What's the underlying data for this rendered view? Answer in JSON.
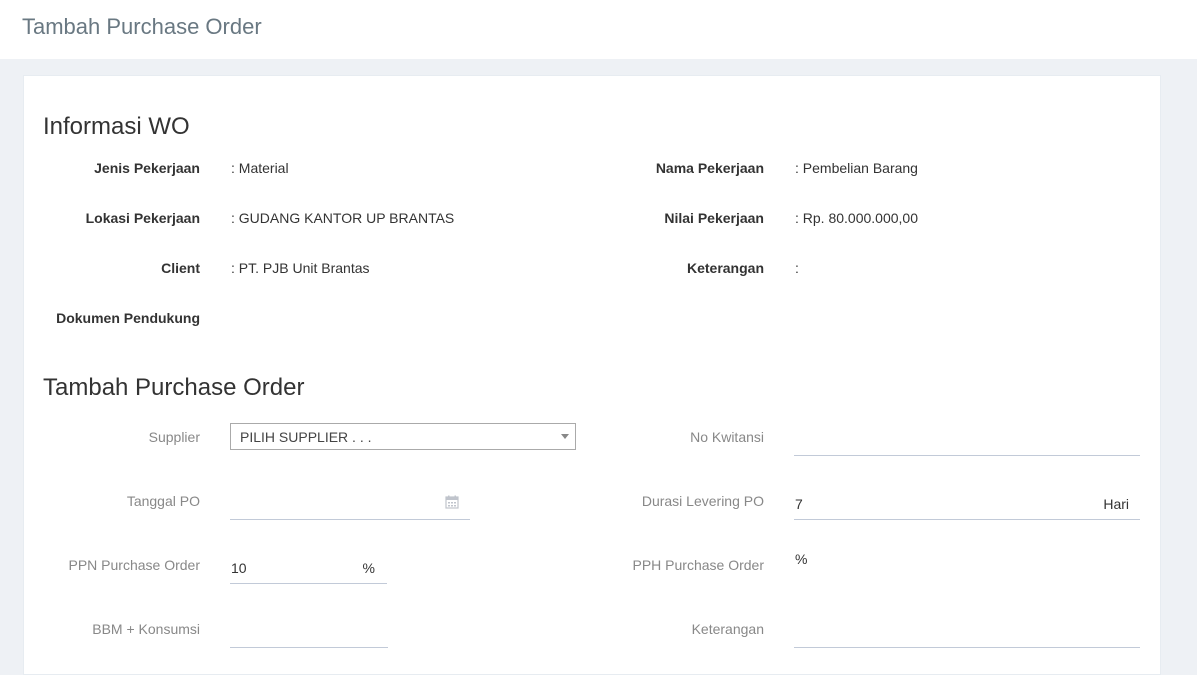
{
  "header": {
    "title": "Tambah Purchase Order"
  },
  "info": {
    "title": "Informasi WO",
    "jenis_pekerjaan": {
      "label": "Jenis Pekerjaan",
      "value": ": Material"
    },
    "nama_pekerjaan": {
      "label": "Nama Pekerjaan",
      "value": ": Pembelian Barang"
    },
    "lokasi_pekerjaan": {
      "label": "Lokasi Pekerjaan",
      "value": ": GUDANG KANTOR UP BRANTAS"
    },
    "nilai_pekerjaan": {
      "label": "Nilai Pekerjaan",
      "value": ": Rp. 80.000.000,00"
    },
    "client": {
      "label": "Client",
      "value": ": PT. PJB Unit Brantas"
    },
    "keterangan": {
      "label": "Keterangan",
      "value": ":"
    },
    "dokumen_pendukung": {
      "label": "Dokumen Pendukung"
    }
  },
  "form": {
    "title": "Tambah Purchase Order",
    "supplier": {
      "label": "Supplier",
      "selected": "PILIH SUPPLIER . . ."
    },
    "no_kwitansi": {
      "label": "No Kwitansi",
      "value": ""
    },
    "tanggal_po": {
      "label": "Tanggal PO",
      "value": "",
      "icon": "calendar-icon"
    },
    "durasi_levering": {
      "label": "Durasi Levering PO",
      "value": "7",
      "suffix": "Hari"
    },
    "ppn": {
      "label": "PPN Purchase Order",
      "value": "10",
      "suffix": "%"
    },
    "pph": {
      "label": "PPH Purchase Order",
      "suffix": "%"
    },
    "bbm": {
      "label": "BBM + Konsumsi",
      "value": ""
    },
    "keterangan": {
      "label": "Keterangan",
      "value": ""
    }
  }
}
